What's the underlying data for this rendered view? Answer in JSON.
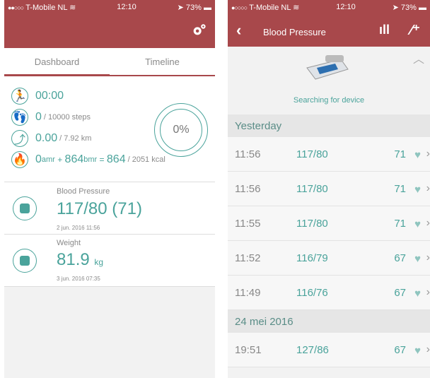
{
  "left": {
    "status": {
      "carrier": "T-Mobile NL",
      "time": "12:10",
      "battery": "73%"
    },
    "tabs": [
      {
        "label": "Dashboard"
      },
      {
        "label": "Timeline"
      }
    ],
    "summary": {
      "time": "00:00",
      "steps": "0",
      "steps_goal": "/ 10000 steps",
      "distance": "0.00",
      "distance_goal": "/ 7.92 km",
      "amr_val": "0",
      "amr_label": "amr",
      "plus": " + ",
      "bmr_val": "864",
      "bmr_label": "bmr",
      "eq": " = ",
      "total": "864",
      "kcal_goal": "/ 2051 kcal",
      "percent": "0%"
    },
    "cards": [
      {
        "label": "Blood Pressure",
        "value": "117/80 (71)",
        "date": "2 jun. 2016 11:56"
      },
      {
        "label": "Weight",
        "value": "81.9",
        "unit": "kg",
        "date": "3 jun. 2016 07:35"
      }
    ]
  },
  "right": {
    "status": {
      "carrier": "T-Mobile NL",
      "time": "12:10",
      "battery": "73%"
    },
    "title": "Blood Pressure",
    "search": "Searching for device",
    "sections": [
      {
        "title": "Yesterday",
        "rows": [
          {
            "time": "11:56",
            "bp": "117/80",
            "pulse": "71"
          },
          {
            "time": "11:56",
            "bp": "117/80",
            "pulse": "71"
          },
          {
            "time": "11:55",
            "bp": "117/80",
            "pulse": "71"
          },
          {
            "time": "11:52",
            "bp": "116/79",
            "pulse": "67"
          },
          {
            "time": "11:49",
            "bp": "116/76",
            "pulse": "67"
          }
        ]
      },
      {
        "title": "24 mei 2016",
        "rows": [
          {
            "time": "19:51",
            "bp": "127/86",
            "pulse": "67"
          }
        ]
      }
    ]
  }
}
